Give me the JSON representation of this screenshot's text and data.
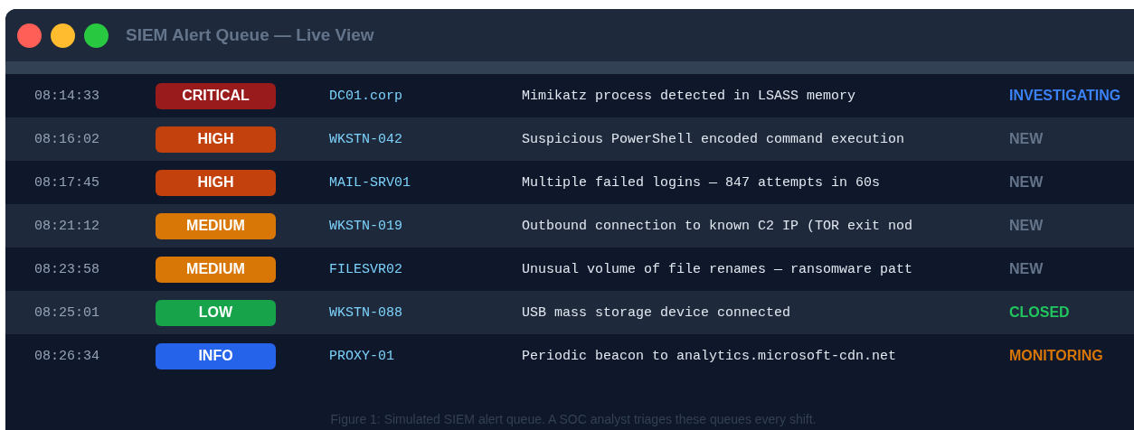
{
  "window": {
    "title": "SIEM Alert Queue — Live View"
  },
  "alerts": [
    {
      "time": "08:14:33",
      "severity": {
        "label": "CRITICAL",
        "color": "#991b1b"
      },
      "host": "DC01.corp",
      "description": "Mimikatz process detected in LSASS memory",
      "status": {
        "label": "INVESTIGATING",
        "color": "#3b82f6"
      }
    },
    {
      "time": "08:16:02",
      "severity": {
        "label": "HIGH",
        "color": "#c2410c"
      },
      "host": "WKSTN-042",
      "description": "Suspicious PowerShell encoded command execution",
      "status": {
        "label": "NEW",
        "color": "#64748b"
      }
    },
    {
      "time": "08:17:45",
      "severity": {
        "label": "HIGH",
        "color": "#c2410c"
      },
      "host": "MAIL-SRV01",
      "description": "Multiple failed logins — 847 attempts in 60s",
      "status": {
        "label": "NEW",
        "color": "#64748b"
      }
    },
    {
      "time": "08:21:12",
      "severity": {
        "label": "MEDIUM",
        "color": "#d97706"
      },
      "host": "WKSTN-019",
      "description": "Outbound connection to known C2 IP (TOR exit nod",
      "status": {
        "label": "NEW",
        "color": "#64748b"
      }
    },
    {
      "time": "08:23:58",
      "severity": {
        "label": "MEDIUM",
        "color": "#d97706"
      },
      "host": "FILESVR02",
      "description": "Unusual volume of file renames — ransomware patt",
      "status": {
        "label": "NEW",
        "color": "#64748b"
      }
    },
    {
      "time": "08:25:01",
      "severity": {
        "label": "LOW",
        "color": "#16a34a"
      },
      "host": "WKSTN-088",
      "description": "USB mass storage device connected",
      "status": {
        "label": "CLOSED",
        "color": "#22c55e"
      }
    },
    {
      "time": "08:26:34",
      "severity": {
        "label": "INFO",
        "color": "#2563eb"
      },
      "host": "PROXY-01",
      "description": "Periodic beacon to analytics.microsoft-cdn.net",
      "status": {
        "label": "MONITORING",
        "color": "#d97706"
      }
    }
  ],
  "caption": "Figure 1: Simulated SIEM alert queue. A SOC analyst triages these queues every shift."
}
